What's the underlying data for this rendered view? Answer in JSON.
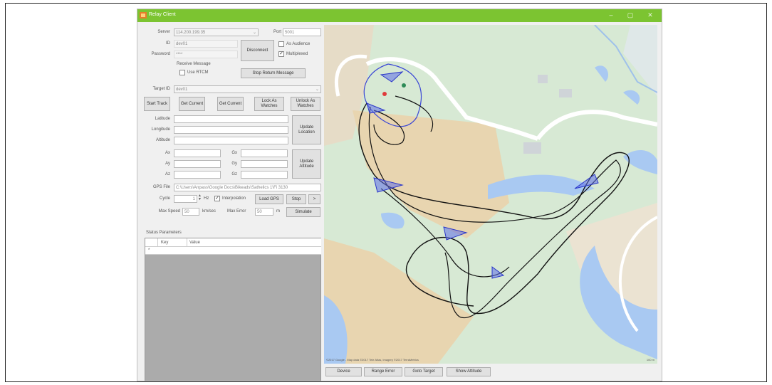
{
  "window": {
    "title": "Relay Client",
    "minimize": "–",
    "maximize": "▢",
    "close": "✕"
  },
  "connection": {
    "server_label": "Server",
    "server_value": "114.200.199.35",
    "port_label": "Port",
    "port_value": "5001",
    "id_label": "ID",
    "id_value": "dev01",
    "password_label": "Password",
    "password_value": "****",
    "disconnect_label": "Disconnect",
    "as_audience_label": "As Audience",
    "as_audience_checked": false,
    "multiplexed_label": "Multiplexed",
    "multiplexed_checked": true,
    "receive_message_label": "Receive Message",
    "use_rtcm_label": "Use RTCM",
    "use_rtcm_checked": false,
    "stop_return_label": "Stop Return Message"
  },
  "target": {
    "label": "Target ID",
    "value": "dev01",
    "buttons": [
      "Start Track",
      "Get Current",
      "Get Current",
      "Lock As Watches",
      "Unlock As Watches"
    ]
  },
  "location": {
    "latitude_label": "Latitude",
    "longitude_label": "Longitude",
    "altitude_label": "Altitude",
    "update_location_label": "Update Location"
  },
  "attitude": {
    "ax_label": "Ax",
    "ay_label": "Ay",
    "az_label": "Az",
    "gx_label": "Gx",
    "gy_label": "Gy",
    "gz_label": "Gz",
    "update_attitude_label": "Update Attitude"
  },
  "gps": {
    "file_label": "GPS File",
    "file_value": "C:\\Users\\Anpass\\Google Docs\\Bikeads\\Sathelics 1\\Fi 3130",
    "cycle_label": "Cycle",
    "cycle_value": "1",
    "cycle_unit": "Hz",
    "interpolation_label": "Interpolation",
    "interpolation_checked": true,
    "load_gps_label": "Load GPS",
    "stop_label": "Stop",
    "extra_label": ">",
    "max_speed_label": "Max Speed",
    "max_speed_value": "50",
    "max_speed_unit": "km/sec",
    "max_error_label": "Max Error",
    "max_error_value": "50",
    "max_error_unit": "m",
    "simulate_label": "Simulate"
  },
  "status": {
    "label": "Status Parameters",
    "columns": [
      "Key",
      "Value"
    ],
    "rows": [
      [
        "*",
        ""
      ]
    ]
  },
  "bottom_buttons": [
    "Device",
    "Range Error",
    "Goto Target",
    "Show Attitude"
  ],
  "map": {
    "attribution": "©2017 Google - Map data ©2017 Tele Atlas, Imagery ©2017 TerraMetrics",
    "scale": "100 m"
  },
  "colors": {
    "titlebar": "#7cc431",
    "map_park": "#d7e9d4",
    "map_tan": "#e8d5b0",
    "map_water": "#a9c9f2",
    "track": "#111111",
    "heading_fill": "#5c6ee8"
  }
}
